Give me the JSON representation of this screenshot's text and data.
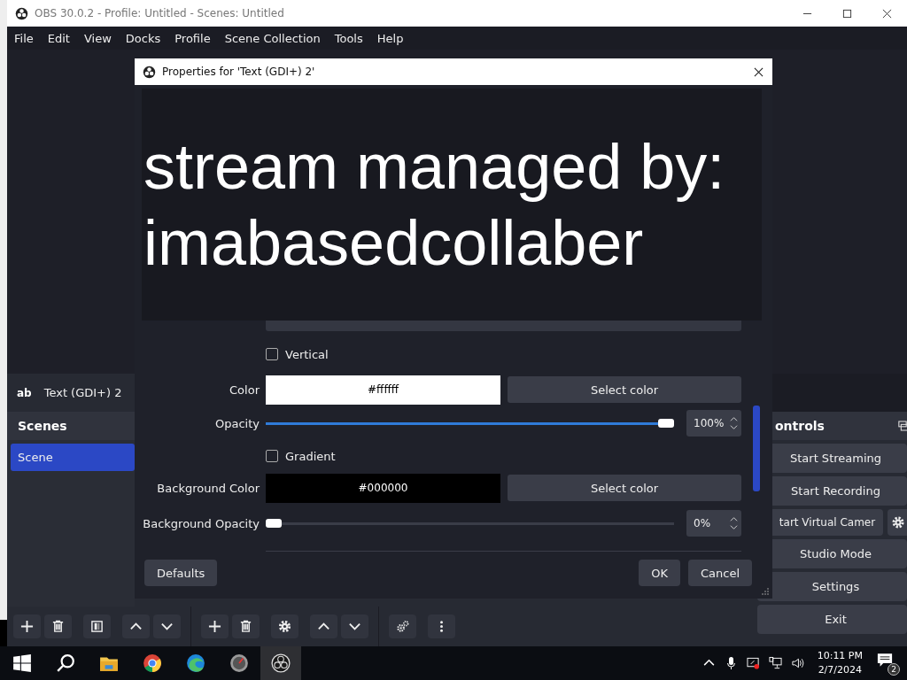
{
  "window": {
    "title": "OBS 30.0.2 - Profile: Untitled - Scenes: Untitled"
  },
  "menu": [
    "File",
    "Edit",
    "View",
    "Docks",
    "Profile",
    "Scene Collection",
    "Tools",
    "Help"
  ],
  "sources": [
    {
      "icon_text": "ab",
      "name": "Text (GDI+) 2"
    }
  ],
  "scenes": {
    "title": "Scenes",
    "items": [
      {
        "name": "Scene",
        "selected": true
      }
    ]
  },
  "controls": {
    "title": "ontrols",
    "buttons": [
      {
        "kind": "plain",
        "label": "Start Streaming"
      },
      {
        "kind": "plain",
        "label": "Start Recording"
      },
      {
        "kind": "split",
        "label": "tart Virtual Camer"
      },
      {
        "kind": "plain",
        "label": "Studio Mode"
      },
      {
        "kind": "plain",
        "label": "Settings"
      },
      {
        "kind": "plain",
        "label": "Exit"
      }
    ]
  },
  "dialog": {
    "title": "Properties for 'Text (GDI+) 2'",
    "preview_lines": [
      "stream managed by:",
      "imabasedcollaber"
    ],
    "fields": [
      {
        "kind": "checkbox",
        "label": "Vertical",
        "checked": false
      },
      {
        "kind": "color",
        "label": "Color",
        "value": "#ffffff",
        "button": "Select color"
      },
      {
        "kind": "slider",
        "label": "Opacity",
        "level": 1,
        "reading": "100%"
      },
      {
        "kind": "checkbox",
        "label": "Gradient",
        "checked": false
      },
      {
        "kind": "color",
        "label": "Background Color",
        "value": "#000000",
        "button": "Select color"
      },
      {
        "kind": "slider",
        "label": "Background Opacity",
        "level": 0,
        "reading": "0%"
      }
    ],
    "defaults": "Defaults",
    "ok": "OK",
    "cancel": "Cancel"
  },
  "taskbar": {
    "time": "10:11 PM",
    "date": "2/7/2024",
    "notifications": "2"
  }
}
